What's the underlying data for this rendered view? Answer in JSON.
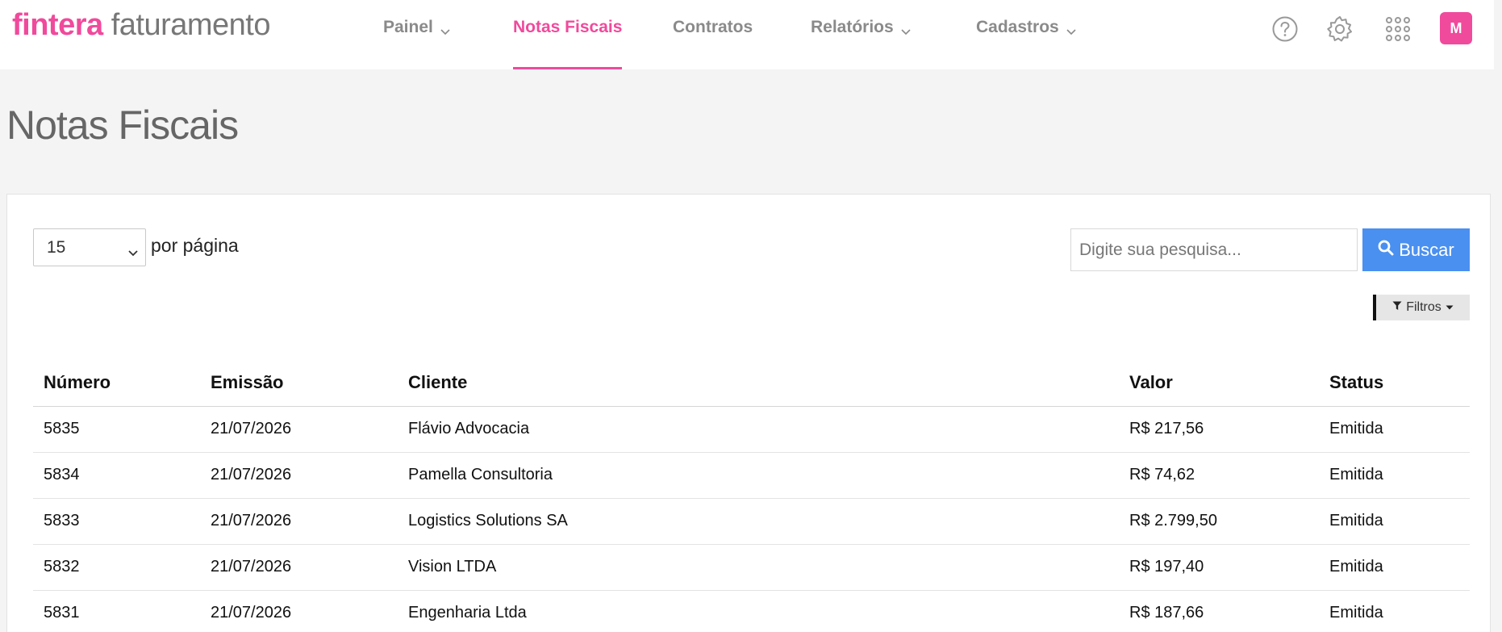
{
  "logo": {
    "brand": "fintera",
    "product": "faturamento"
  },
  "nav": {
    "items": [
      {
        "label": "Painel",
        "dropdown": true,
        "active": false
      },
      {
        "label": "Notas Fiscais",
        "dropdown": false,
        "active": true
      },
      {
        "label": "Contratos",
        "dropdown": false,
        "active": false
      },
      {
        "label": "Relatórios",
        "dropdown": true,
        "active": false
      },
      {
        "label": "Cadastros",
        "dropdown": true,
        "active": false
      }
    ]
  },
  "header_icons": [
    "help-icon",
    "gear-icon",
    "apps-grid-icon"
  ],
  "user": {
    "avatar_initial": "M"
  },
  "page": {
    "title": "Notas Fiscais"
  },
  "toolbar": {
    "per_page_value": "15",
    "per_page_label": "por página",
    "search_placeholder": "Digite sua pesquisa...",
    "search_button": "Buscar",
    "filters_button": "Filtros"
  },
  "table": {
    "columns": [
      "Número",
      "Emissão",
      "Cliente",
      "Valor",
      "Status"
    ],
    "rows": [
      [
        "5835",
        "21/07/2026",
        "Flávio Advocacia",
        "R$ 217,56",
        "Emitida"
      ],
      [
        "5834",
        "21/07/2026",
        "Pamella Consultoria",
        "R$ 74,62",
        "Emitida"
      ],
      [
        "5833",
        "21/07/2026",
        "Logistics Solutions SA",
        "R$ 2.799,50",
        "Emitida"
      ],
      [
        "5832",
        "21/07/2026",
        "Vision LTDA",
        "R$ 197,40",
        "Emitida"
      ],
      [
        "5831",
        "21/07/2026",
        "Engenharia Ltda",
        "R$ 187,66",
        "Emitida"
      ]
    ]
  },
  "colors": {
    "accent": "#f04a9c",
    "search_button": "#4a90f0",
    "nav_text": "#8a8a8a",
    "page_background": "#f4f4f4"
  }
}
